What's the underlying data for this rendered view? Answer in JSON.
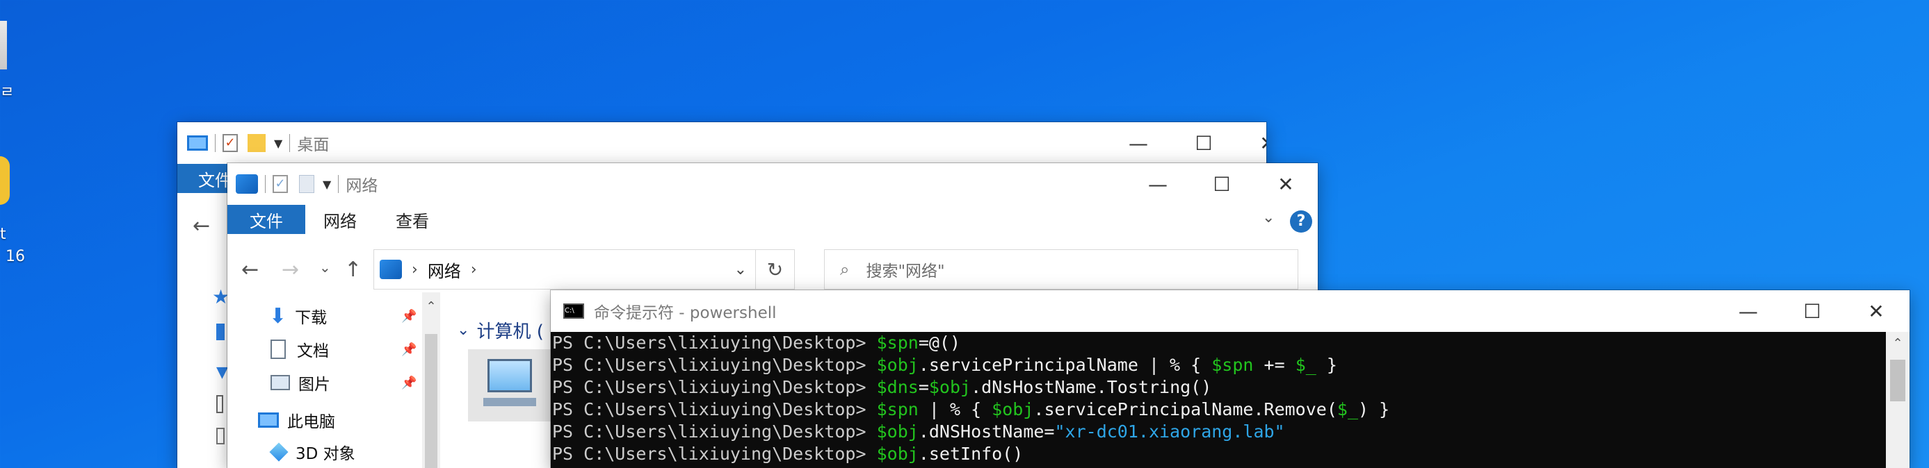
{
  "desktop": {
    "icon_label_1": "t",
    "icon_label_2": "16"
  },
  "window_desktop": {
    "title": "桌面",
    "tab_file": "文件"
  },
  "window_network": {
    "title": "网络",
    "tabs": [
      "文件",
      "网络",
      "查看"
    ],
    "address": {
      "crumb": "网络"
    },
    "search_placeholder": "搜索\"网络\"",
    "sidebar": [
      {
        "label": "下载",
        "icon": "download-arrow-icon"
      },
      {
        "label": "文档",
        "icon": "document-icon"
      },
      {
        "label": "图片",
        "icon": "pictures-icon"
      },
      {
        "label": "此电脑",
        "icon": "this-pc-icon"
      },
      {
        "label": "3D 对象",
        "icon": "3d-objects-icon"
      }
    ],
    "group_header": "计算机 ("
  },
  "cmd_window": {
    "title": "命令提示符 - powershell",
    "lines": [
      {
        "prompt": "PS C:\\Users\\lixiuying\\Desktop> ",
        "parts": [
          {
            "t": "$spn",
            "c": "g"
          },
          {
            "t": "=@()",
            "c": "w"
          }
        ]
      },
      {
        "prompt": "PS C:\\Users\\lixiuying\\Desktop> ",
        "parts": [
          {
            "t": "$obj",
            "c": "g"
          },
          {
            "t": ".servicePrincipalName | % { ",
            "c": "w"
          },
          {
            "t": "$spn",
            "c": "g"
          },
          {
            "t": " += ",
            "c": "w"
          },
          {
            "t": "$_",
            "c": "g"
          },
          {
            "t": " }",
            "c": "w"
          }
        ]
      },
      {
        "prompt": "PS C:\\Users\\lixiuying\\Desktop> ",
        "parts": [
          {
            "t": "$dns",
            "c": "g"
          },
          {
            "t": "=",
            "c": "w"
          },
          {
            "t": "$obj",
            "c": "g"
          },
          {
            "t": ".dNsHostName.Tostring()",
            "c": "w"
          }
        ]
      },
      {
        "prompt": "PS C:\\Users\\lixiuying\\Desktop> ",
        "parts": [
          {
            "t": "$spn",
            "c": "g"
          },
          {
            "t": " | % { ",
            "c": "w"
          },
          {
            "t": "$obj",
            "c": "g"
          },
          {
            "t": ".servicePrincipalName.Remove(",
            "c": "w"
          },
          {
            "t": "$_",
            "c": "g"
          },
          {
            "t": ") }",
            "c": "w"
          }
        ]
      },
      {
        "prompt": "PS C:\\Users\\lixiuying\\Desktop> ",
        "parts": [
          {
            "t": "$obj",
            "c": "g"
          },
          {
            "t": ".dNSHostName=",
            "c": "w"
          },
          {
            "t": "\"xr-dc01.xiaorang.lab\"",
            "c": "s"
          }
        ]
      },
      {
        "prompt": "PS C:\\Users\\lixiuying\\Desktop> ",
        "parts": [
          {
            "t": "$obj",
            "c": "g"
          },
          {
            "t": ".setInfo()",
            "c": "w"
          }
        ]
      }
    ]
  },
  "colors": {
    "ribbon_active": "#1e6fc0",
    "console_bg": "#0c0c0c",
    "ps_variable": "#22c31e",
    "ps_string": "#2ea5e6"
  }
}
